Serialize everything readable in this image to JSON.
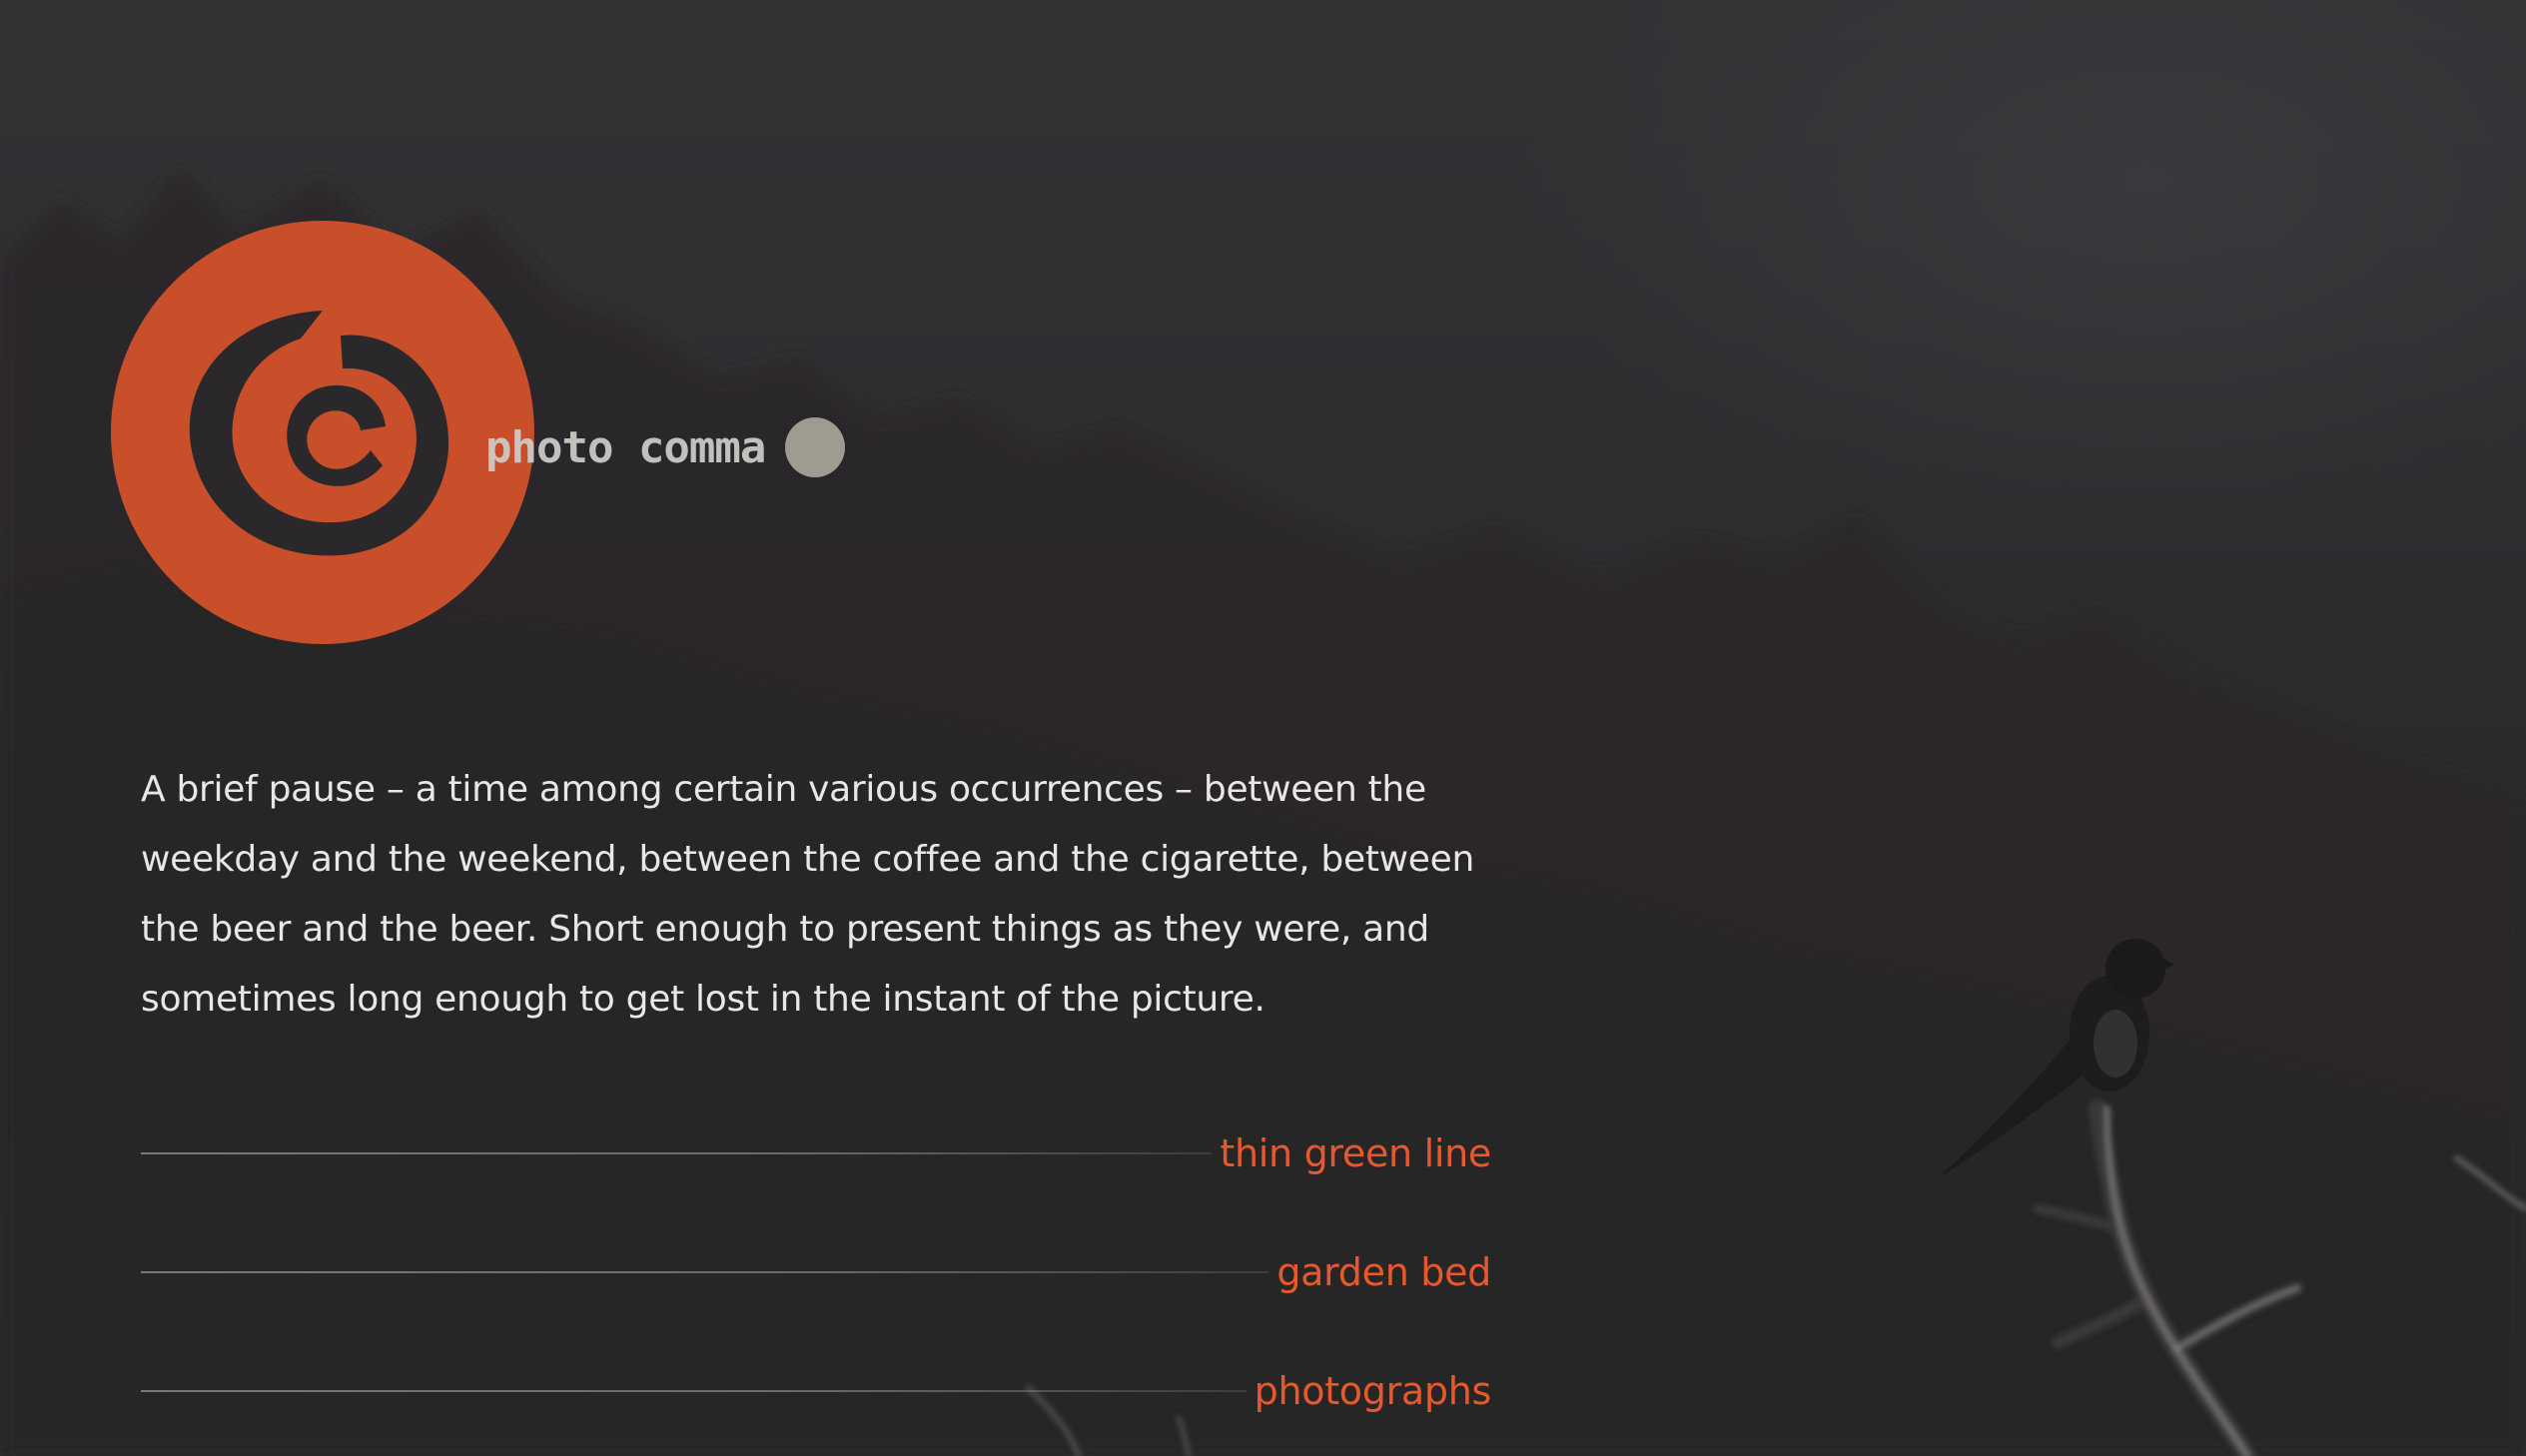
{
  "brand": {
    "name": "photo comma",
    "accent_color": "#c94f2a",
    "dot_color": "#9e9b90",
    "logo_icon": "spiral-comma-icon"
  },
  "intro": {
    "text": "A brief pause – a time among certain various occurrences – between the weekday and the weekend, between the coffee and the cigarette, between the beer and the beer. Short enough to present things as they were, and sometimes long enough to get lost in the instant of the picture."
  },
  "nav": {
    "link_color": "#e8582c",
    "items": [
      {
        "label": "thin green line"
      },
      {
        "label": "garden bed"
      },
      {
        "label": "photographs"
      }
    ]
  }
}
